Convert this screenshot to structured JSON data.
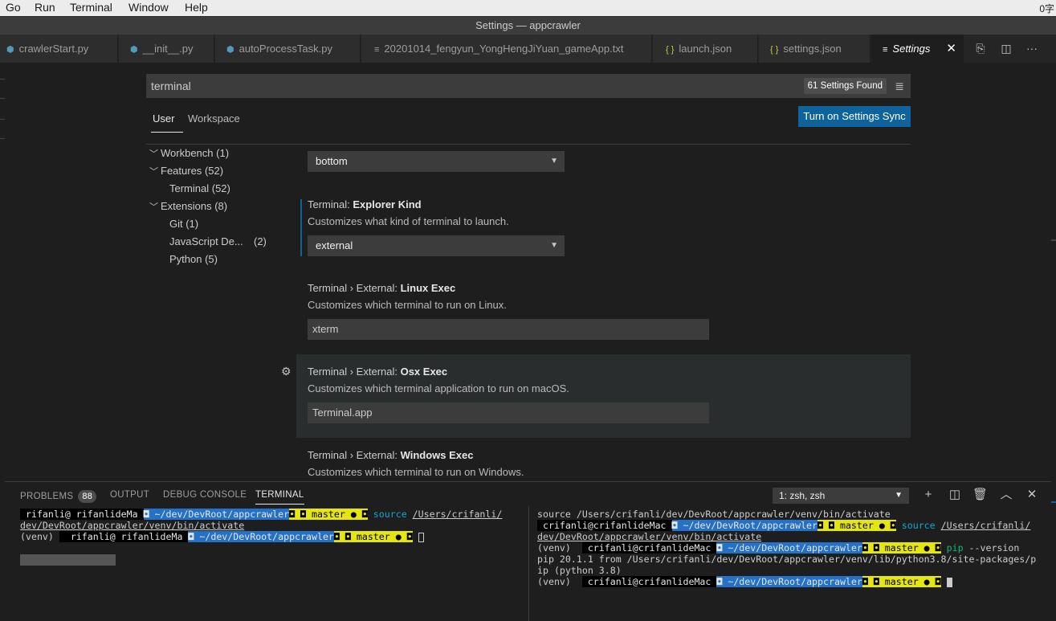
{
  "menubar": {
    "items": [
      "Go",
      "Run",
      "Terminal",
      "Window",
      "Help"
    ],
    "right": "0字"
  },
  "window": {
    "title": "Settings — appcrawler"
  },
  "tabs": [
    {
      "label": "crawlerStart.py",
      "icon": "python-icon"
    },
    {
      "label": "__init__.py",
      "icon": "python-icon"
    },
    {
      "label": "autoProcessTask.py",
      "icon": "python-icon"
    },
    {
      "label": "20201014_fengyun_YongHengJiYuan_gameApp.txt",
      "icon": "text-file-icon"
    },
    {
      "label": "launch.json",
      "icon": "json-icon"
    },
    {
      "label": "settings.json",
      "icon": "json-icon"
    },
    {
      "label": "Settings",
      "icon": "settings-file-icon",
      "active": true
    }
  ],
  "settings": {
    "search_value": "terminal",
    "found": "61 Settings Found",
    "scope_tabs": [
      "User",
      "Workspace"
    ],
    "sync_button": "Turn on Settings Sync",
    "toc": [
      {
        "label": "Workbench",
        "count": "(1)"
      },
      {
        "label": "Features",
        "count": "(52)"
      },
      {
        "label": "Terminal (52)"
      },
      {
        "label": "Extensions",
        "count": "(8)"
      },
      {
        "label": "Git (1)"
      },
      {
        "label": "JavaScript De...",
        "count": "(2)"
      },
      {
        "label": "Python (5)"
      }
    ],
    "items": [
      {
        "value": "bottom"
      },
      {
        "prefix": "Terminal: ",
        "name": "Explorer Kind",
        "desc": "Customizes what kind of terminal to launch.",
        "value": "external"
      },
      {
        "prefix": "Terminal › External: ",
        "name": "Linux Exec",
        "desc": "Customizes which terminal to run on Linux.",
        "value": "xterm"
      },
      {
        "prefix": "Terminal › External: ",
        "name": "Osx Exec",
        "desc": "Customizes which terminal application to run on macOS.",
        "value": "Terminal.app"
      },
      {
        "prefix": "Terminal › External: ",
        "name": "Windows Exec",
        "desc": "Customizes which terminal to run on Windows."
      }
    ]
  },
  "panel": {
    "tabs": [
      "PROBLEMS",
      "OUTPUT",
      "DEBUG CONSOLE",
      "TERMINAL"
    ],
    "problems_count": "88",
    "terminal_select": "1: zsh, zsh"
  },
  "terminal_left": {
    "l1_user": " rifanli@ rifanlideMa ",
    "l1_path": "~/dev/DevRoot/appcrawler",
    "l1_branch": " master ● ",
    "l1_cmd": "source",
    "l1_arg": "/Users/crifanli/",
    "l2": "dev/DevRoot/appcrawler/venv/bin/activate",
    "l3_prefix": "(venv) ",
    "l3_user": "  rifanli@ rifanlideMa ",
    "l3_path": "~/dev/DevRoot/appcrawler",
    "l3_branch": " master ● "
  },
  "terminal_right": {
    "l1": "source /Users/crifanli/dev/DevRoot/appcrawler/venv/bin/activate",
    "l2_user": " crifanli@crifanlideMac ",
    "l2_path": "~/dev/DevRoot/appcrawler",
    "l2_branch": " master ● ",
    "l2_cmd": "source",
    "l2_arg": "/Users/crifanli/",
    "l3": "dev/DevRoot/appcrawler/venv/bin/activate",
    "l4_prefix": "(venv)  ",
    "l4_user": " crifanli@crifanlideMac ",
    "l4_path": "~/dev/DevRoot/appcrawler",
    "l4_branch": " master ● ",
    "l4_cmd": "pip",
    "l4_arg": " --version",
    "l5": "pip 20.1.1 from /Users/crifanli/dev/DevRoot/appcrawler/venv/lib/python3.8/site-packages/p",
    "l6": "ip (python 3.8)",
    "l7_prefix": "(venv)  ",
    "l7_user": " crifanli@crifanlideMac ",
    "l7_path": "~/dev/DevRoot/appcrawler",
    "l7_branch": " master ● "
  }
}
